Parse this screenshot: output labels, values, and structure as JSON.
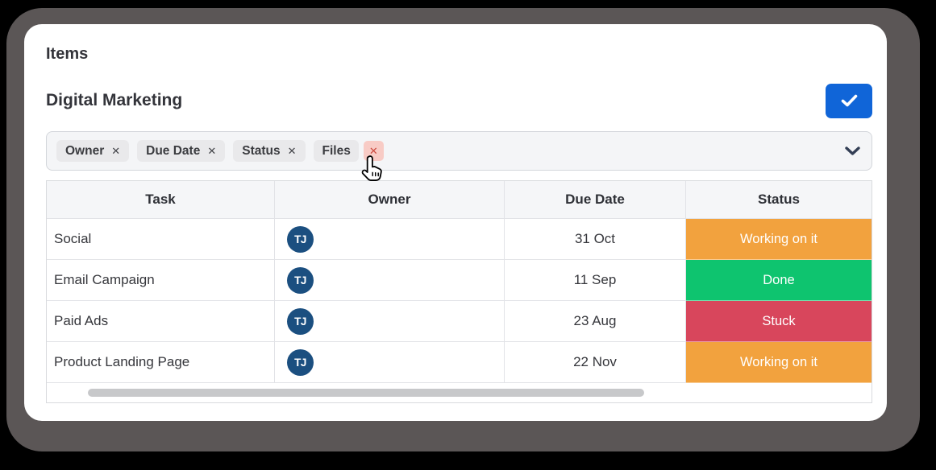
{
  "window": {
    "title": "Items"
  },
  "board": {
    "name": "Digital Marketing",
    "confirm_button_icon": "check"
  },
  "filter_bar": {
    "remove_glyph": "✕",
    "expand_icon": "chevron-down",
    "chips": [
      {
        "label": "Owner"
      },
      {
        "label": "Due Date"
      },
      {
        "label": "Status"
      },
      {
        "label": "Files",
        "remove_highlighted": true
      }
    ]
  },
  "table": {
    "columns": [
      {
        "label": "Task"
      },
      {
        "label": "Owner"
      },
      {
        "label": "Due Date"
      },
      {
        "label": "Status"
      }
    ],
    "rows": [
      {
        "task": "Social",
        "owner_initials": "TJ",
        "due_date": "31 Oct",
        "status": "Working on it",
        "status_color": "#f2a23e"
      },
      {
        "task": "Email Campaign",
        "owner_initials": "TJ",
        "due_date": "11 Sep",
        "status": "Done",
        "status_color": "#0ec46f"
      },
      {
        "task": "Paid Ads",
        "owner_initials": "TJ",
        "due_date": "23 Aug",
        "status": "Stuck",
        "status_color": "#d8465c"
      },
      {
        "task": "Product Landing Page",
        "owner_initials": "TJ",
        "due_date": "22 Nov",
        "status": "Working on it",
        "status_color": "#f2a23e"
      }
    ]
  },
  "colors": {
    "accent_blue": "#1065d8",
    "avatar_bg": "#1b4f80",
    "status_working_on_it": "#f2a23e",
    "status_done": "#0ec46f",
    "status_stuck": "#d8465c",
    "remove_highlight_bg": "#f8cbc5",
    "remove_highlight_fg": "#cc4b40",
    "frame_shadow": "#5b5656"
  }
}
